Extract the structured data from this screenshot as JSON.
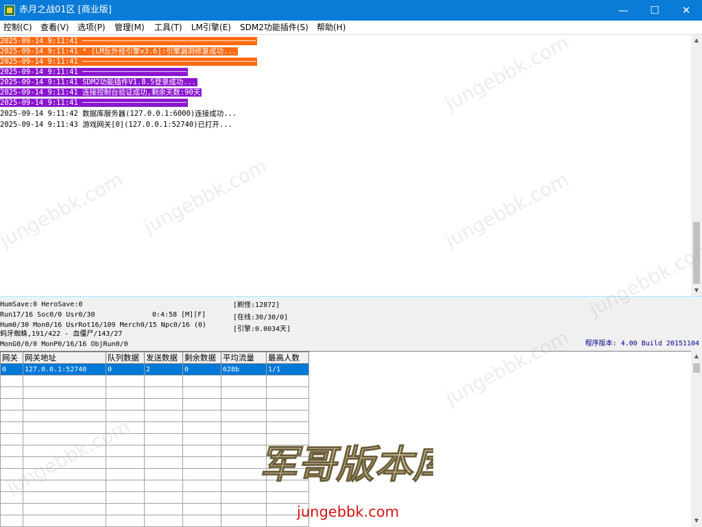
{
  "window": {
    "title": "赤月之战01区 [商业版]",
    "min_glyph": "—",
    "max_glyph": "☐",
    "close_glyph": "✕"
  },
  "menu": [
    {
      "label": "控制(C)"
    },
    {
      "label": "查看(V)"
    },
    {
      "label": "选项(P)"
    },
    {
      "label": "管理(M)"
    },
    {
      "label": "工具(T)"
    },
    {
      "label": "LM引擎(E)"
    },
    {
      "label": "SDM2功能插件(S)"
    },
    {
      "label": "帮助(H)"
    }
  ],
  "log": [
    {
      "text": "2025-09-14 9:11:41 ────────────────────────────────────────",
      "style": "orange"
    },
    {
      "text": "2025-09-14 9:11:41 * [LM反外挂引擎v3.6]:引擎漏洞修复成功...",
      "style": "orange"
    },
    {
      "text": "2025-09-14 9:11:41 ────────────────────────────────────────",
      "style": "orange"
    },
    {
      "text": "2025-09-14 9:11:41 ────────────────────────",
      "style": "purple"
    },
    {
      "text": "2025-09-14 9:11:41 SDM2功能插件V1.8.5登录成功...",
      "style": "purple"
    },
    {
      "text": "2025-09-14 9:11:41 连接控制台验证成功,剩余天数:90天",
      "style": "purple"
    },
    {
      "text": "2025-09-14 9:11:41 ────────────────────────",
      "style": "purple"
    },
    {
      "text": "2025-09-14 9:11:42 数据库服务器(127.0.0.1:6000)连接成功...",
      "style": "plain"
    },
    {
      "text": "2025-09-14 9:11:43 游戏网关[0](127.0.0.1:52740)已打开...",
      "style": "plain"
    }
  ],
  "status": {
    "line1": "HumSave:0 HeroSave:0",
    "line2a": "Run17/16 Soc0/0 Usr0/30",
    "line2b": "0:4:58 [M][F]",
    "line3": "Hum0/30 Mon0/16 UsrRot16/109 Merch0/15 Npc0/16 (0)",
    "line4": "蚂牙蜘蛛,191/422 - 血僵尸/143/27",
    "line5": "MonG0/0/0 MonP0/16/16 ObjRun0/0",
    "refresh": "[刷怪:12872]",
    "online": "[在线:30/30/0]",
    "engine": "[引擎:0.0034天]",
    "version": "程序版本: 4.00 Build 20151104"
  },
  "grid": {
    "headers": [
      "网关",
      "网关地址",
      "队列数据",
      "发送数据",
      "剩余数据",
      "平均流量",
      "最高人数"
    ],
    "rows": [
      [
        "0",
        "127.0.0.1:52740",
        "0",
        "2",
        "0",
        "628b",
        "1/1"
      ]
    ]
  },
  "watermark": {
    "text": "jungebbk.com",
    "logo_text": "军哥版本库",
    "url": "jungebbk.com"
  },
  "colors": {
    "titlebar": "#0a7bd6",
    "orange": "#ff6a13",
    "purple": "#8b16cf",
    "selection": "#0078d7",
    "version_text": "#00008b",
    "watermark_url": "#d21414"
  }
}
